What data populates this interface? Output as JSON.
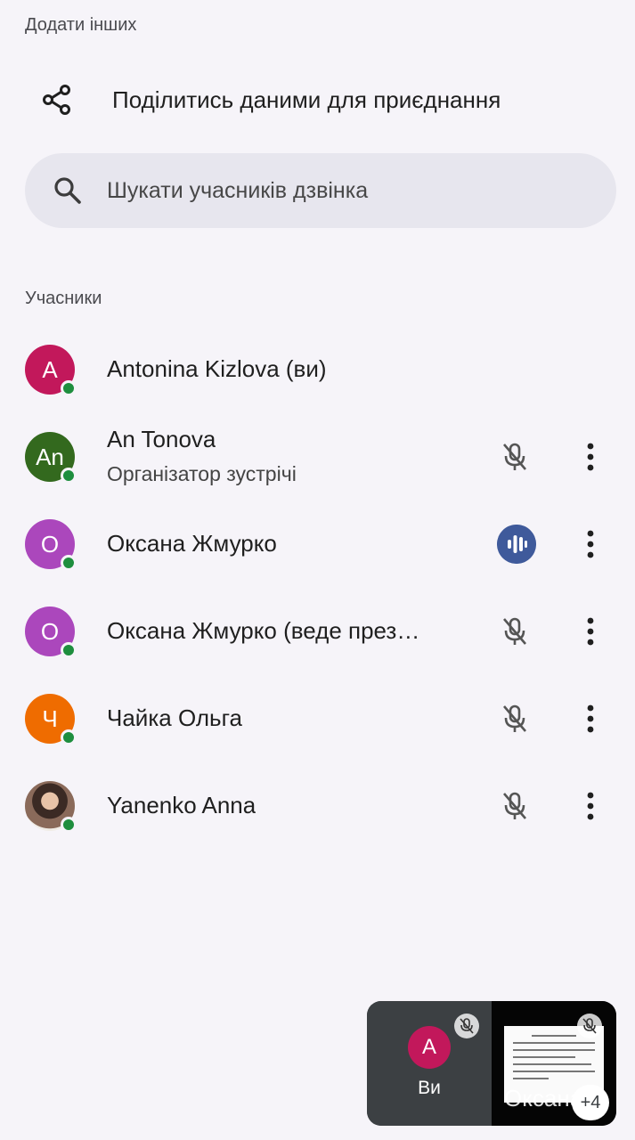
{
  "add_others": {
    "label": "Додати інших"
  },
  "share": {
    "label": "Поділитись даними для приєднання",
    "icon": "share-icon"
  },
  "search": {
    "placeholder": "Шукати учасників дзвінка",
    "icon": "search-icon"
  },
  "participants": {
    "label": "Учасники",
    "items": [
      {
        "initial": "A",
        "color": "#c2185b",
        "name": "Antonina Kizlova (ви)",
        "subtitle": "",
        "status": "none"
      },
      {
        "initial": "An",
        "color": "#33691e",
        "name": "An Tonova",
        "subtitle": "Організатор зустрічі",
        "status": "muted"
      },
      {
        "initial": "О",
        "color": "#ab47bc",
        "name": "Оксана Жмурко",
        "subtitle": "",
        "status": "speaking"
      },
      {
        "initial": "О",
        "color": "#ab47bc",
        "name": "Оксана Жмурко (веде през…",
        "subtitle": "",
        "status": "muted"
      },
      {
        "initial": "Ч",
        "color": "#ef6c00",
        "name": "Чайка Ольга",
        "subtitle": "",
        "status": "muted"
      },
      {
        "initial": "",
        "color": "#5d4037",
        "name": "Yanenko Anna",
        "subtitle": "",
        "status": "muted",
        "photo": true
      }
    ]
  },
  "pip": {
    "self_initial": "A",
    "self_label": "Ви",
    "other_label": "Оксана",
    "extra_count": "+4"
  }
}
